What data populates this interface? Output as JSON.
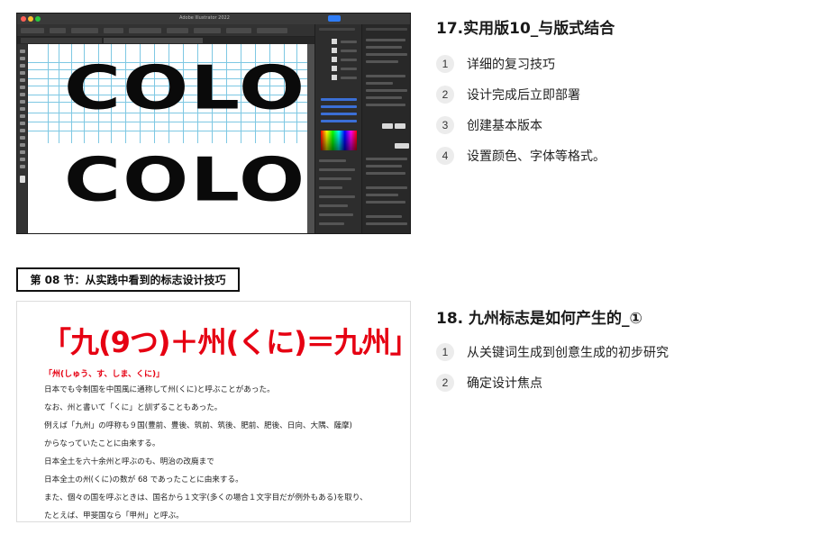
{
  "screenshot": {
    "app_title": "Adobe Illustrator 2022",
    "artwork_text": "COLO",
    "colors": {
      "chrome": "#2b2b2b",
      "canvas": "#ffffff",
      "guides": "#7ec8e3",
      "share": "#2f7df6",
      "artwork": "#0a0a0a"
    }
  },
  "section17": {
    "title": "17.实用版10_与版式结合",
    "items": [
      {
        "num": "1",
        "text": "详细的复习技巧"
      },
      {
        "num": "2",
        "text": "设计完成后立即部署"
      },
      {
        "num": "3",
        "text": "创建基本版本"
      },
      {
        "num": "4",
        "text": "设置颜色、字体等格式。"
      }
    ]
  },
  "section_label": "第 08 节：从实践中看到的标志设计技巧",
  "section18": {
    "title": "18. 九州标志是如何产生的_①",
    "items": [
      {
        "num": "1",
        "text": "从关键词生成到创意生成的初步研究"
      },
      {
        "num": "2",
        "text": "确定设计焦点"
      }
    ]
  },
  "doc": {
    "accent_color": "#e60012",
    "title": "「九(9つ)＋州(くに)＝九州」",
    "subtitle": "「州(しゅう、す、しま、くに)」",
    "lines": [
      "日本でも令制国を中国風に通称して州(くに)と呼ぶことがあった。",
      "なお、州と書いて「くに」と訓ずることもあった。",
      "例えば「九州」の呼称も９国(豊前、豊後、筑前、筑後、肥前、肥後、日向、大隅、薩摩)",
      "からなっていたことに由来する。",
      "日本全土を六十余州と呼ぶのも、明治の改廃まで",
      "日本全土の州(くに)の数が 68 であったことに由来する。",
      "また、個々の国を呼ぶときは、国名から１文字(多くの場合１文字目だが例外もある)を取り、",
      "たとえば、甲斐国なら「甲州」と呼ぶ。"
    ]
  }
}
